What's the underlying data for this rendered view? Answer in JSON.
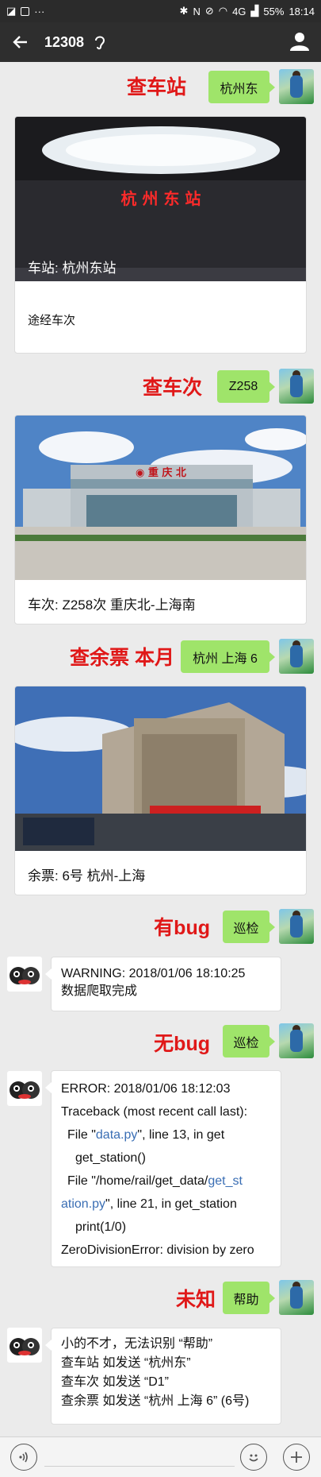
{
  "status_bar": {
    "battery": "55%",
    "time": "18:14",
    "network": "4G"
  },
  "header": {
    "title": "12308"
  },
  "messages": [
    {
      "label": "查车站",
      "query": "杭州东",
      "card_caption_overlay": "车站: 杭州东站",
      "card_caption": "途经车次"
    },
    {
      "label": "查车次",
      "query": "Z258",
      "station_sign": "重庆北",
      "card_caption": "车次: Z258次 重庆北-上海南"
    },
    {
      "label": "查余票 本月",
      "query": "杭州 上海 6",
      "card_caption": "余票: 6号 杭州-上海"
    },
    {
      "label": "有bug",
      "query": "巡检",
      "reply_lines": [
        "WARNING: 2018/01/06 18:10:25",
        "数据爬取完成"
      ]
    },
    {
      "label": "无bug",
      "query": "巡检",
      "reply": {
        "line1": "ERROR: 2018/01/06 18:12:03",
        "line2": "Traceback (most recent call last):",
        "line3a": "File \"",
        "line3_link": "data.py",
        "line3b": "\", line 13, in get",
        "line4": "get_station()",
        "line5a": "File \"/home/rail/get_data/",
        "line5_link1": "get_st",
        "line6_link2": "ation.py",
        "line6b": "\", line 21, in get_station",
        "line7": "print(1/0)",
        "line8": "ZeroDivisionError: division by zero"
      }
    },
    {
      "label": "未知",
      "query": "帮助",
      "reply_lines": [
        "小的不才，无法识别 “帮助”",
        "查车站 如发送 “杭州东”",
        "查车次 如发送 “D1”",
        "查余票 如发送 “杭州 上海 6” (6号)"
      ]
    }
  ],
  "icons": [
    "back-arrow-icon",
    "ear-icon",
    "profile-icon",
    "voice-icon",
    "emoji-icon",
    "plus-icon"
  ],
  "colors": {
    "label_red": "#e01818",
    "bubble_green": "#9fe46a",
    "link_blue": "#3a6eb4",
    "titlebar": "#2e2e2e"
  }
}
